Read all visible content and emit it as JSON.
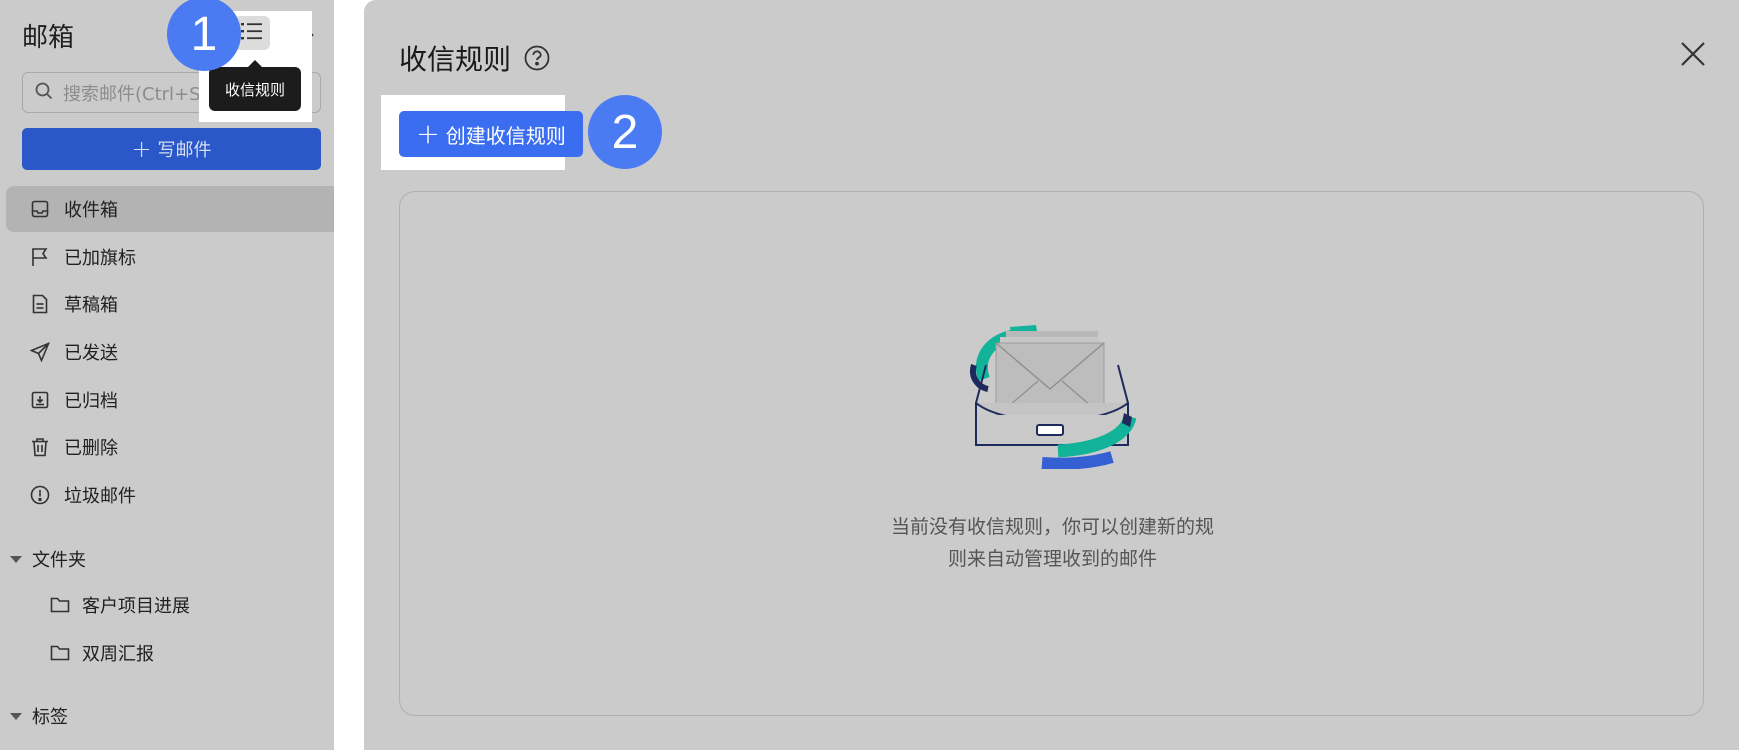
{
  "sidebar": {
    "title": "邮箱",
    "rules_tooltip": "收信规则",
    "search_placeholder": "搜索邮件(Ctrl+Shift+F)",
    "compose_label": "写邮件",
    "nav": [
      {
        "label": "收件箱",
        "icon": "inbox-icon",
        "active": true
      },
      {
        "label": "已加旗标",
        "icon": "flag-icon"
      },
      {
        "label": "草稿箱",
        "icon": "draft-icon"
      },
      {
        "label": "已发送",
        "icon": "send-icon"
      },
      {
        "label": "已归档",
        "icon": "archive-icon"
      },
      {
        "label": "已删除",
        "icon": "trash-icon"
      },
      {
        "label": "垃圾邮件",
        "icon": "spam-icon"
      }
    ],
    "folders_heading": "文件夹",
    "folders": [
      {
        "label": "客户项目进展",
        "icon": "folder-icon"
      },
      {
        "label": "双周汇报",
        "icon": "folder-icon"
      }
    ],
    "tags_heading": "标签"
  },
  "steps": {
    "one": "1",
    "two": "2"
  },
  "modal": {
    "title": "收信规则",
    "create_label": "创建收信规则",
    "empty_line1": "当前没有收信规则，你可以创建新的规",
    "empty_line2": "则来自动管理收到的邮件"
  },
  "colors": {
    "primary": "#3a6df0",
    "compose_dimmed": "#2a58c9",
    "badge": "#4a7bf2",
    "overlay_gray": "#cbcbcb",
    "illustration_teal": "#13b39a",
    "illustration_navy": "#1f2a5c"
  }
}
